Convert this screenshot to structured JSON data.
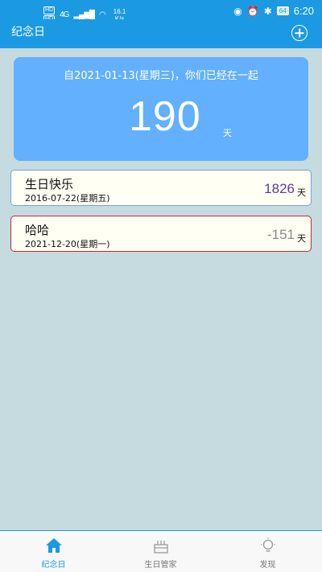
{
  "status_bar": {
    "sim1": "HD",
    "sim2": "HD",
    "network": "4G",
    "speed_value": "16.1",
    "speed_unit": "K/s",
    "battery": "64",
    "time": "6:20"
  },
  "app_bar": {
    "title": "纪念日"
  },
  "hero": {
    "text": "自2021-01-13(星期三)，你们已经在一起",
    "days": "190",
    "unit": "天"
  },
  "events": [
    {
      "name": "生日快乐",
      "date": "2016-07-22(星期五)",
      "count": "1826",
      "unit": "天"
    },
    {
      "name": "哈哈",
      "date": "2021-12-20(星期一)",
      "count": "-151",
      "unit": "天"
    }
  ],
  "bottom_nav": {
    "items": [
      {
        "label": "纪念日",
        "icon": "home-icon",
        "active": true
      },
      {
        "label": "生日管家",
        "icon": "cake-icon",
        "active": false
      },
      {
        "label": "发现",
        "icon": "lightbulb-icon",
        "active": false
      }
    ]
  },
  "colors": {
    "primary": "#1b9ae3",
    "hero_bg": "#62b0ff",
    "page_bg": "#c5dbe0",
    "positive_count": "#5a3d9c",
    "negative_count": "#8a8a8a",
    "negative_border": "#c42a2a"
  }
}
